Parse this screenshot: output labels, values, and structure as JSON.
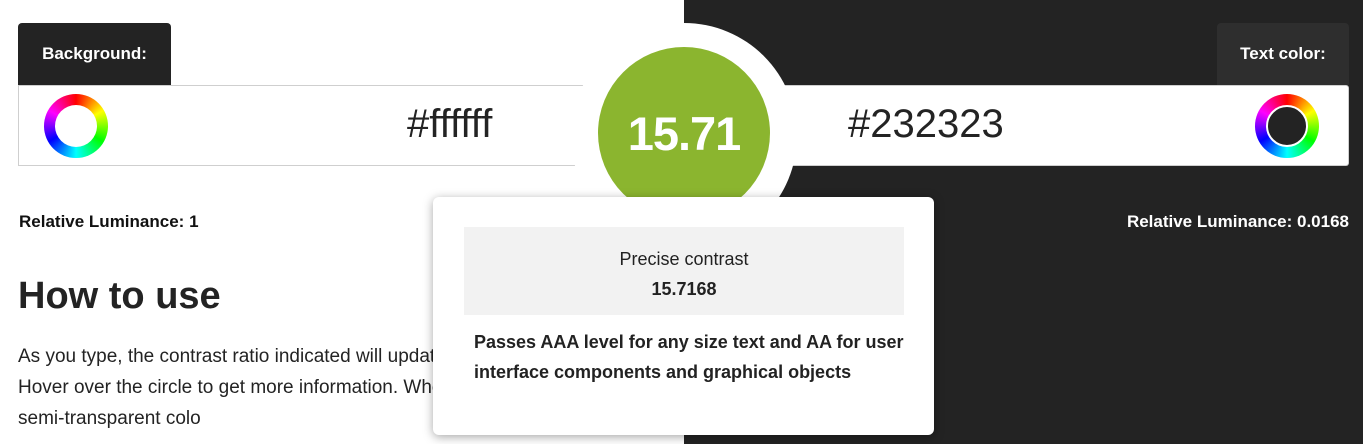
{
  "background": {
    "tab_label": "Background:",
    "hex_value": "#ffffff",
    "luminance_label": "Relative Luminance:",
    "luminance_value": "1",
    "color": "#ffffff"
  },
  "text_color": {
    "tab_label": "Text color:",
    "hex_value": "#232323",
    "luminance_label": "Relative Luminance:",
    "luminance_value": "0.0168",
    "color": "#232323"
  },
  "contrast": {
    "ratio": "15.71",
    "indicator_color": "#8bb52f"
  },
  "tooltip": {
    "label": "Precise contrast",
    "value": "15.7168",
    "message": "Passes AAA level for any size text and AA for user interface components and graphical objects"
  },
  "how_to_use": {
    "title": "How to use",
    "text": "As you type, the contrast ratio indicated will update. Hover over the circle to get more information. When semi-transparent colo"
  },
  "icons": [
    "color-wheel-icon"
  ]
}
